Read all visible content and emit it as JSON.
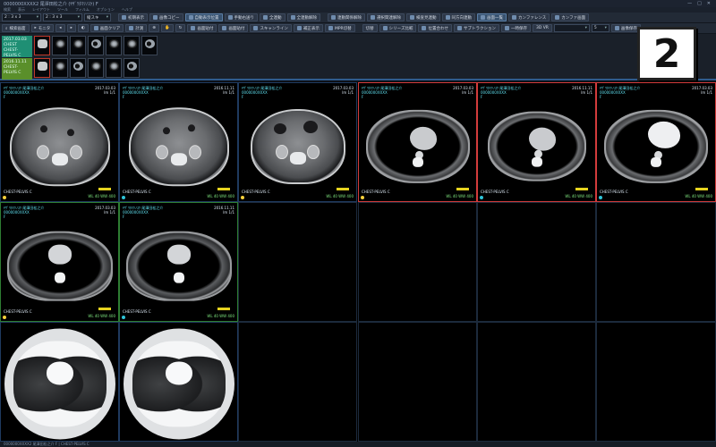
{
  "window": {
    "title": "0000000XXXX2 尾澤田松之介 (ﾔｻﾞﾜﾀﾏﾂﾉｽｹ) F"
  },
  "menu": [
    "検索",
    "表示",
    "レイアウト",
    "ツール",
    "フィルム",
    "オプション",
    "ヘルプ"
  ],
  "toolbar1": {
    "layout1": "2 : 3 x 3",
    "layout2": "2 : 3 x 3",
    "mode": "縦スキ",
    "buttons": [
      "初期表示",
      "画像コピー",
      "自動表示位置",
      "手動右送り",
      "全連動",
      "全連動解除",
      "連動関係解除",
      "選択関連解除",
      "検査見連動",
      "同方向連動",
      "画面一覧",
      "カンファレンス",
      "カンファ画面"
    ]
  },
  "toolbar2": {
    "search_label": "検索画面",
    "monitor_label": "モニタ",
    "buttons": [
      "画面クリア",
      "計測",
      "画面貼付",
      "画面貼付",
      "スキャンライン",
      "補正表示",
      "MPR切替",
      "切替",
      "シリーズ比較",
      "位置合わせ",
      "サブトラクション",
      "一時保存",
      "3D VR",
      "画像保存"
    ],
    "preset_value": "",
    "series_value": "5"
  },
  "studies": [
    {
      "date": "2017.03.03",
      "desc1": "CHEST",
      "desc2": "CHEST-PELVIS C"
    },
    {
      "date": "2016.11.11",
      "desc1": "",
      "desc2": "CHEST-PELVIS C"
    }
  ],
  "badge": "2",
  "viewer": {
    "patient": "ﾔｻﾞﾜﾀﾏﾂﾉｽｹ 尾澤田松之介",
    "pid": "0000000XXXX",
    "sex": "F",
    "series_desc": "CHEST-PELVIS C",
    "date_a": "2017.03.03",
    "date_b": "2016.11.11",
    "slice_info": "Im 1/1",
    "window_info": "WL 40 WW 400",
    "scale": "5cm"
  },
  "statusbar": "0000000XXXX2 尾澤田松之介 F  |  CHEST-PELVIS C"
}
